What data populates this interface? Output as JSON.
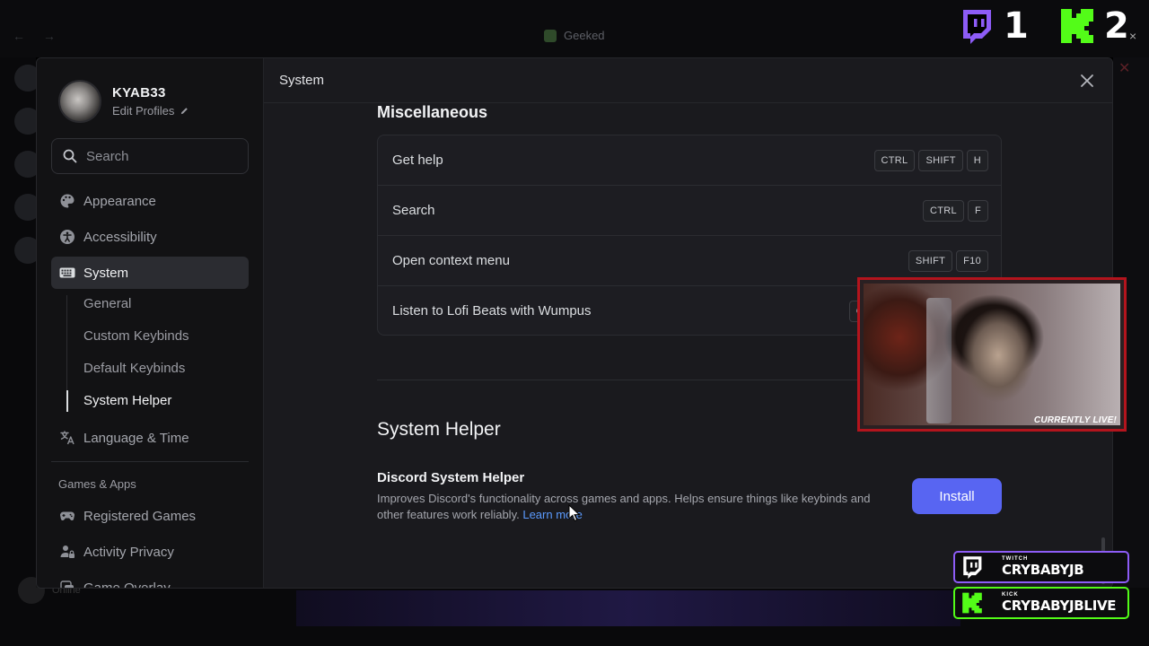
{
  "background": {
    "window_title": "Geeked",
    "nav_arrows": "← →",
    "user_status": "Online",
    "close_glyph": "✕"
  },
  "overlay": {
    "twitch_count": "1",
    "kick_count": "2",
    "webcam_label": "CURRENTLY LIVE!",
    "twitch_tag": "TWITCH",
    "twitch_handle": "CRYBABYJB",
    "kick_tag": "KICK",
    "kick_handle": "CRYBABYJBLIVE",
    "twitch_color": "#8d5cf6",
    "kick_color": "#53fc18",
    "top_close": "×"
  },
  "profile": {
    "name": "KYAB33",
    "edit_label": "Edit Profiles"
  },
  "search": {
    "placeholder": "Search"
  },
  "sidebar": {
    "items": [
      {
        "label": "Appearance",
        "icon": "palette-icon"
      },
      {
        "label": "Accessibility",
        "icon": "accessibility-icon"
      },
      {
        "label": "System",
        "icon": "keyboard-icon",
        "active": true
      }
    ],
    "sub_items": [
      "General",
      "Custom Keybinds",
      "Default Keybinds",
      "System Helper"
    ],
    "language": {
      "label": "Language & Time",
      "icon": "translate-icon"
    },
    "section_label": "Games & Apps",
    "games_items": [
      {
        "label": "Registered Games",
        "icon": "gamepad-icon"
      },
      {
        "label": "Activity Privacy",
        "icon": "person-lock-icon"
      },
      {
        "label": "Game Overlay",
        "icon": "overlay-icon"
      }
    ]
  },
  "header": {
    "title": "System"
  },
  "misc": {
    "title": "Miscellaneous",
    "rows": [
      {
        "label": "Get help",
        "keys": [
          "CTRL",
          "SHIFT",
          "H"
        ]
      },
      {
        "label": "Search",
        "keys": [
          "CTRL",
          "F"
        ]
      },
      {
        "label": "Open context menu",
        "keys": [
          "SHIFT",
          "F10"
        ]
      },
      {
        "label": "Listen to Lofi Beats with Wumpus",
        "keys": [
          "CT"
        ]
      }
    ]
  },
  "system_helper": {
    "title": "System Helper",
    "name": "Discord System Helper",
    "description": "Improves Discord's functionality across games and apps. Helps ensure things like keybinds and other features work reliably.",
    "learn_more": "Learn more",
    "install_label": "Install",
    "accent_color": "#5865f2"
  }
}
